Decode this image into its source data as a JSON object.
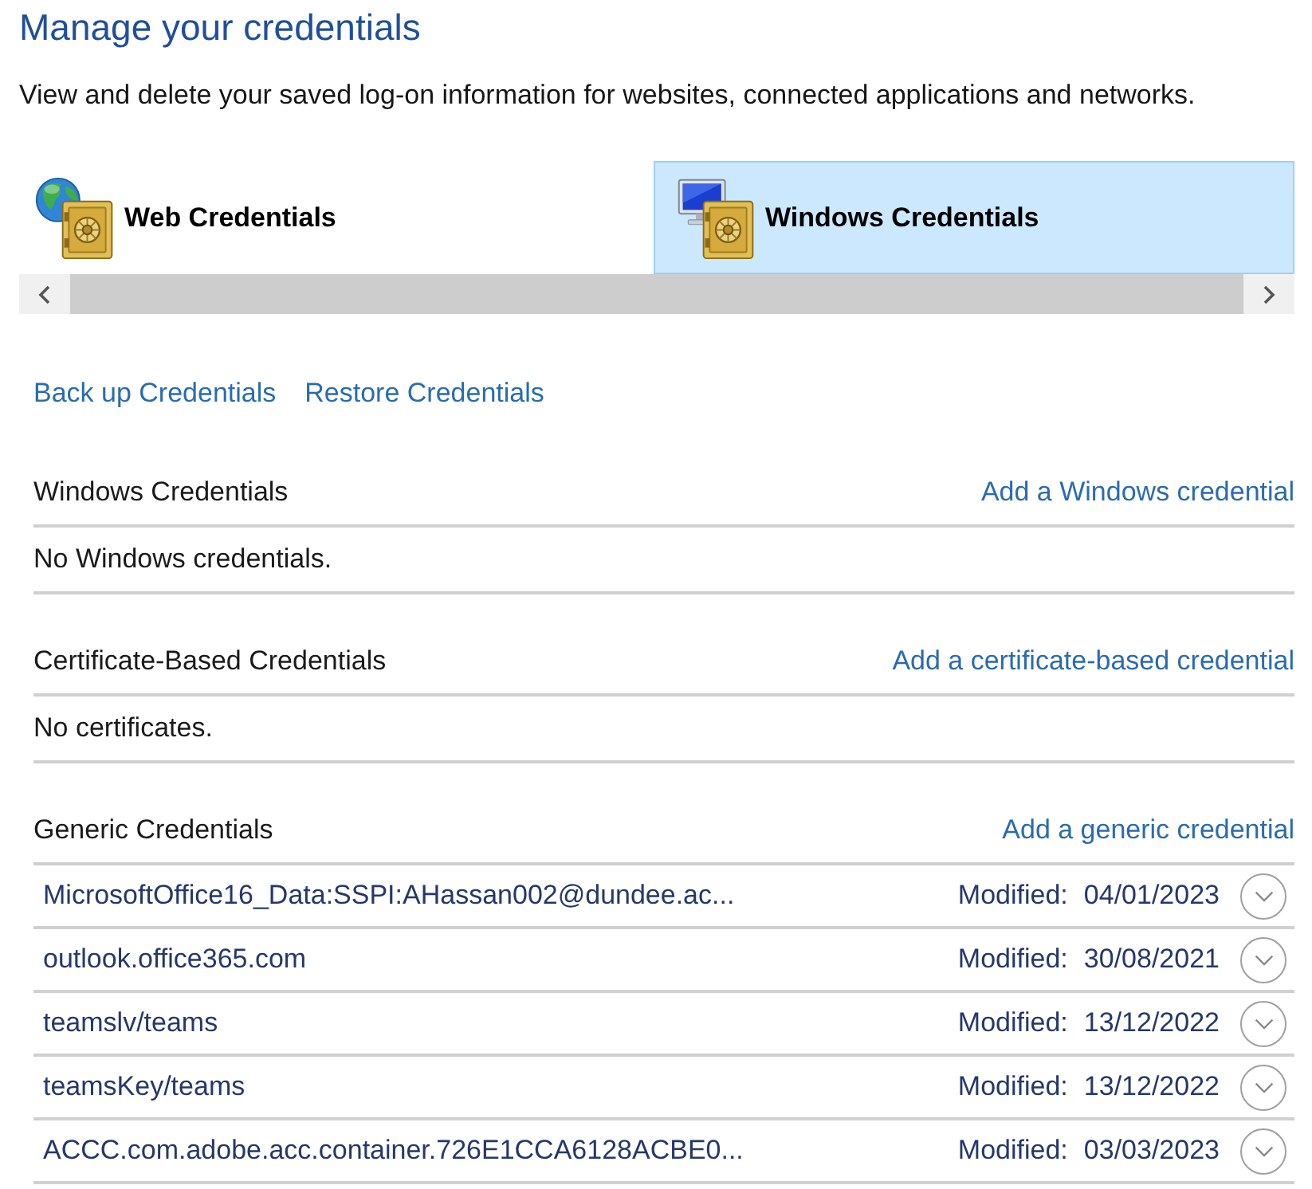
{
  "title": "Manage your credentials",
  "description": "View and delete your saved log-on information for websites, connected applications and networks.",
  "tabs": [
    {
      "label": "Web Credentials",
      "selected": false,
      "kind": "web"
    },
    {
      "label": "Windows Credentials",
      "selected": true,
      "kind": "windows"
    }
  ],
  "actions": [
    "Back up Credentials",
    "Restore Credentials"
  ],
  "sections": [
    {
      "heading": "Windows Credentials",
      "add_link": "Add a Windows credential",
      "empty_text": "No Windows credentials."
    },
    {
      "heading": "Certificate-Based Credentials",
      "add_link": "Add a certificate-based credential",
      "empty_text": "No certificates."
    },
    {
      "heading": "Generic Credentials",
      "add_link": "Add a generic credential",
      "items": [
        {
          "name": "MicrosoftOffice16_Data:SSPI:AHassan002@dundee.ac...",
          "modified_label": "Modified:",
          "date": "04/01/2023",
          "expanded": false
        },
        {
          "name": "outlook.office365.com",
          "modified_label": "Modified:",
          "date": "30/08/2021",
          "expanded": false
        },
        {
          "name": "teamslv/teams",
          "modified_label": "Modified:",
          "date": "13/12/2022",
          "expanded": false
        },
        {
          "name": "teamsKey/teams",
          "modified_label": "Modified:",
          "date": "13/12/2022",
          "expanded": false
        },
        {
          "name": "ACCC.com.adobe.acc.container.726E1CCA6128ACBE0...",
          "modified_label": "Modified:",
          "date": "03/03/2023",
          "expanded": false
        }
      ]
    }
  ]
}
